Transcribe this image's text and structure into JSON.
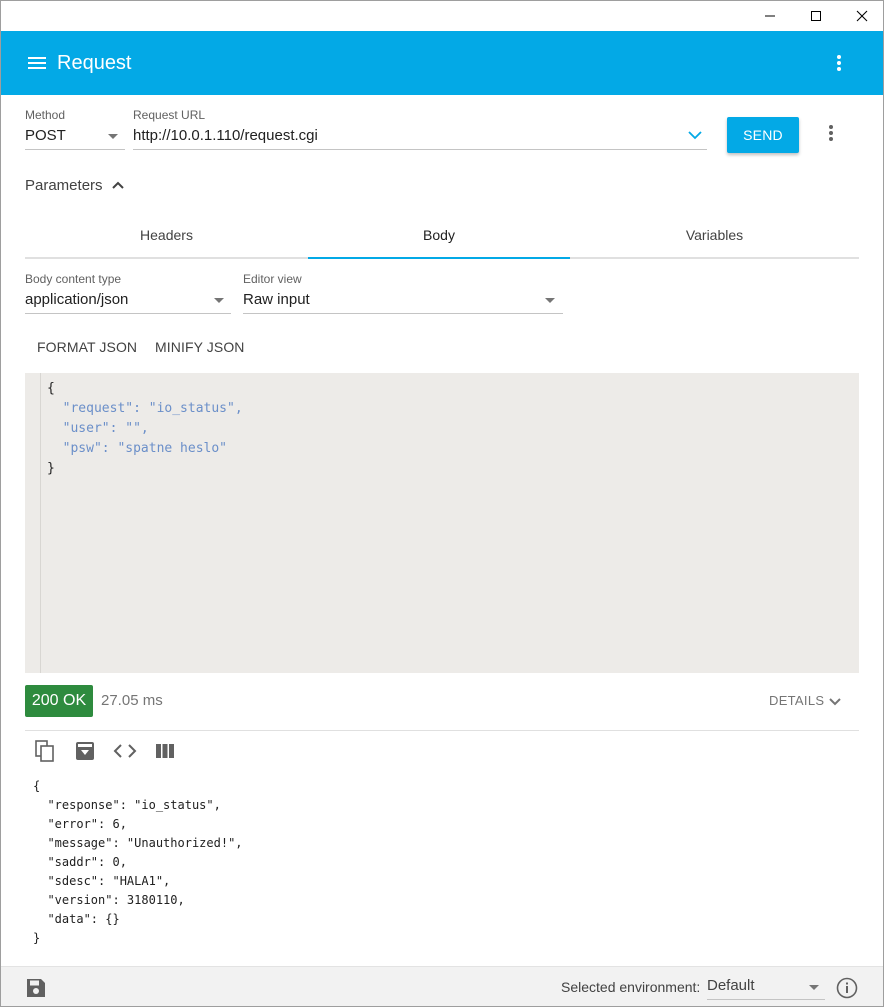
{
  "app": {
    "title": "Request"
  },
  "request": {
    "method_label": "Method",
    "method_value": "POST",
    "url_label": "Request URL",
    "url_value": "http://10.0.1.110/request.cgi",
    "send_label": "SEND"
  },
  "parameters": {
    "label": "Parameters",
    "expanded": true
  },
  "tabs": [
    {
      "label": "Headers",
      "selected": false
    },
    {
      "label": "Body",
      "selected": true
    },
    {
      "label": "Variables",
      "selected": false
    }
  ],
  "body": {
    "content_type_label": "Body content type",
    "content_type_value": "application/json",
    "editor_view_label": "Editor view",
    "editor_view_value": "Raw input",
    "format_json_label": "FORMAT JSON",
    "minify_json_label": "MINIFY JSON",
    "code_lines": [
      "{",
      "  \"request\": \"io_status\",",
      "  \"user\": \"\",",
      "  \"psw\": \"spatne heslo\"",
      "}"
    ]
  },
  "response": {
    "status": "200 OK",
    "time": "27.05 ms",
    "details_label": "DETAILS",
    "tools": [
      "copy-icon",
      "save-response-icon",
      "code-icon",
      "columns-icon"
    ],
    "code_lines": [
      "{",
      "  \"response\": \"io_status\",",
      "  \"error\": 6,",
      "  \"message\": \"Unauthorized!\",",
      "  \"saddr\": 0,",
      "  \"sdesc\": \"HALA1\",",
      "  \"version\": 3180110,",
      "  \"data\": {}",
      "}"
    ]
  },
  "footer": {
    "env_label": "Selected environment:",
    "env_value": "Default"
  },
  "colors": {
    "accent": "#03a9e6",
    "status_ok": "#2e8b3e",
    "editor_bg": "#edebe8"
  }
}
